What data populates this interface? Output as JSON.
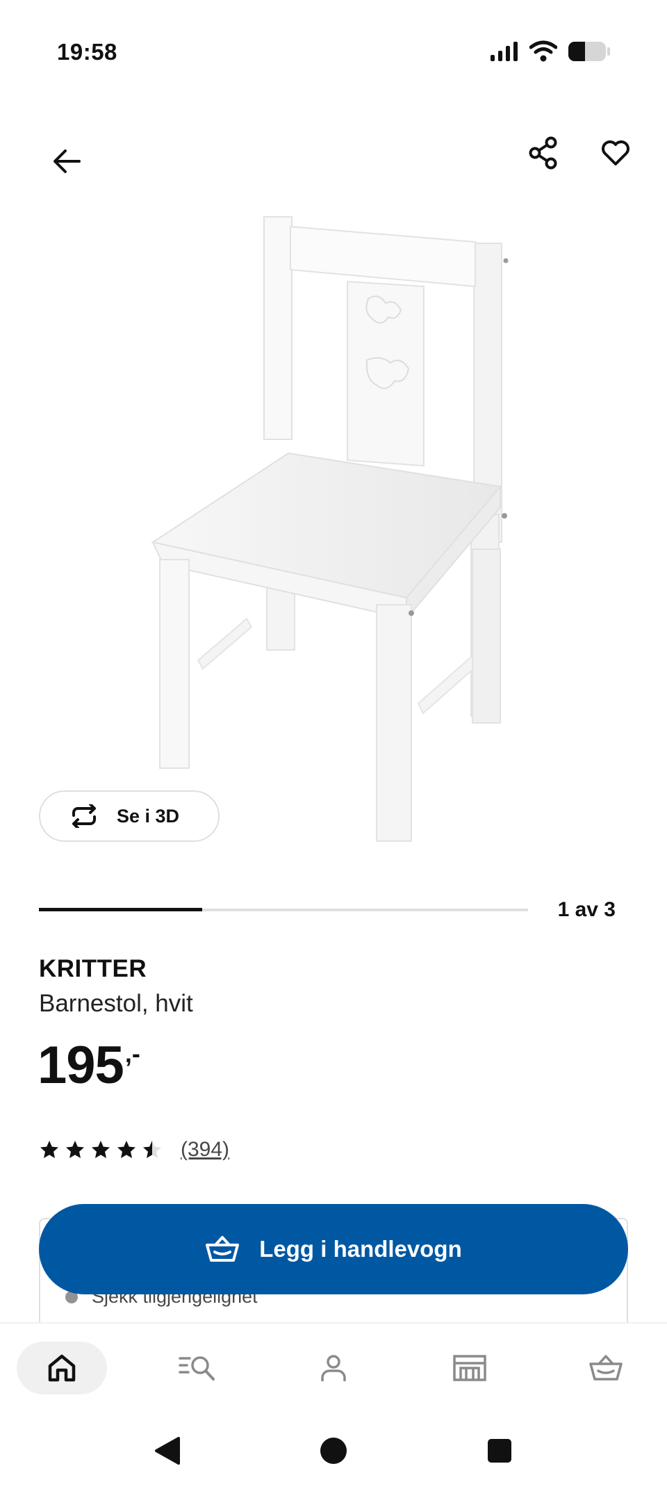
{
  "status_bar": {
    "time": "19:58",
    "icons": [
      "signal-icon",
      "wifi-icon",
      "battery-icon"
    ]
  },
  "top_bar": {
    "icons": [
      "back-arrow-icon",
      "share-icon",
      "heart-icon"
    ]
  },
  "gallery": {
    "view_3d_label": "Se i 3D",
    "page_indicator": "1 av 3",
    "current_page": 1,
    "total_pages": 3
  },
  "product": {
    "name": "KRITTER",
    "description": "Barnestol, hvit",
    "price_main": "195",
    "price_suffix": ",-",
    "rating": 4.5,
    "review_count": "(394)"
  },
  "availability": {
    "text": "Sjekk tilgjengelighet"
  },
  "cart_button": {
    "label": "Legg i handlevogn"
  },
  "bottom_nav": {
    "items": [
      {
        "icon": "home-icon",
        "active": true
      },
      {
        "icon": "search-list-icon",
        "active": false
      },
      {
        "icon": "profile-icon",
        "active": false
      },
      {
        "icon": "store-icon",
        "active": false
      },
      {
        "icon": "cart-icon",
        "active": false
      }
    ]
  },
  "colors": {
    "brand_blue": "#0058a3",
    "text": "#111111",
    "muted": "#484848",
    "border": "#dfdfdf"
  }
}
